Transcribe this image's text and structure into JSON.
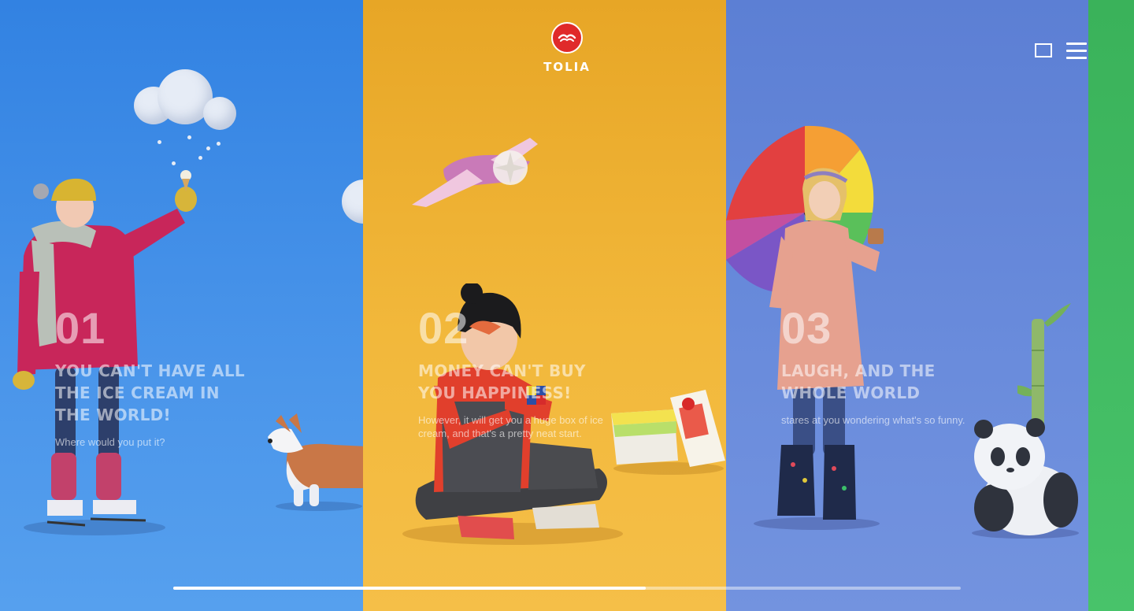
{
  "brand": {
    "name": "TOLIA"
  },
  "controls": {
    "fullscreen_icon": "square-outline-icon",
    "menu_icon": "hamburger-menu-icon"
  },
  "panels": [
    {
      "number": "01",
      "title": "YOU CAN'T HAVE ALL THE ICE CREAM IN THE WORLD!",
      "description": "Where would you put it?",
      "color": "#3a86e4"
    },
    {
      "number": "02",
      "title": "MONEY CAN'T BUY YOU HAPPINESS!",
      "description": "However, it will get you a huge box of ice cream, and that's a pretty neat start.",
      "color": "#efb235"
    },
    {
      "number": "03",
      "title": "LAUGH, AND THE WHOLE WORLD",
      "description": "stares at you wondering what's so funny.",
      "color": "#6687d9"
    },
    {
      "color": "#44bd64"
    }
  ],
  "progress": {
    "value": 0.6
  }
}
